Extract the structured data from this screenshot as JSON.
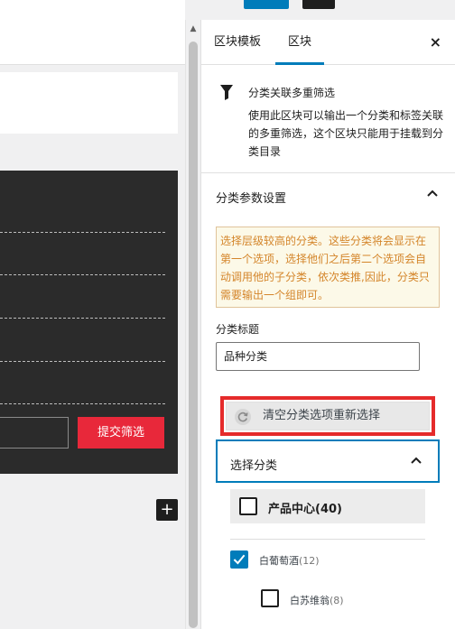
{
  "canvas": {
    "submit_label": "提交筛选",
    "plus_label": "+"
  },
  "sidebar": {
    "tabs": [
      {
        "label": "区块模板",
        "active": false
      },
      {
        "label": "区块",
        "active": true
      }
    ],
    "close_label": "×",
    "block": {
      "icon": "filter-icon",
      "title": "分类关联多重筛选",
      "description": "使用此区块可以输出一个分类和标签关联的多重筛选，这个区块只能用于挂载到分类目录"
    },
    "panel": {
      "title": "分类参数设置",
      "notice": "选择层级较高的分类。这些分类将会显示在第一个选项，选择他们之后第二个选项会自动调用他的子分类，依次类推,因此，分类只需要输出一个组即可。",
      "field_label": "分类标题",
      "field_value": "品种分类",
      "clear_button": "清空分类选项重新选择",
      "select_label": "选择分类",
      "group": {
        "label": "产品中心(40)",
        "checked": false
      },
      "items": [
        {
          "name": "白葡萄酒",
          "count": "(12)",
          "checked": true
        },
        {
          "name": "白苏维翁",
          "count": "(8)",
          "checked": false
        }
      ]
    }
  },
  "colors": {
    "accent": "#007cba",
    "submit": "#e8283a",
    "highlight": "#e52b2b",
    "notice_text": "#d4852a"
  }
}
